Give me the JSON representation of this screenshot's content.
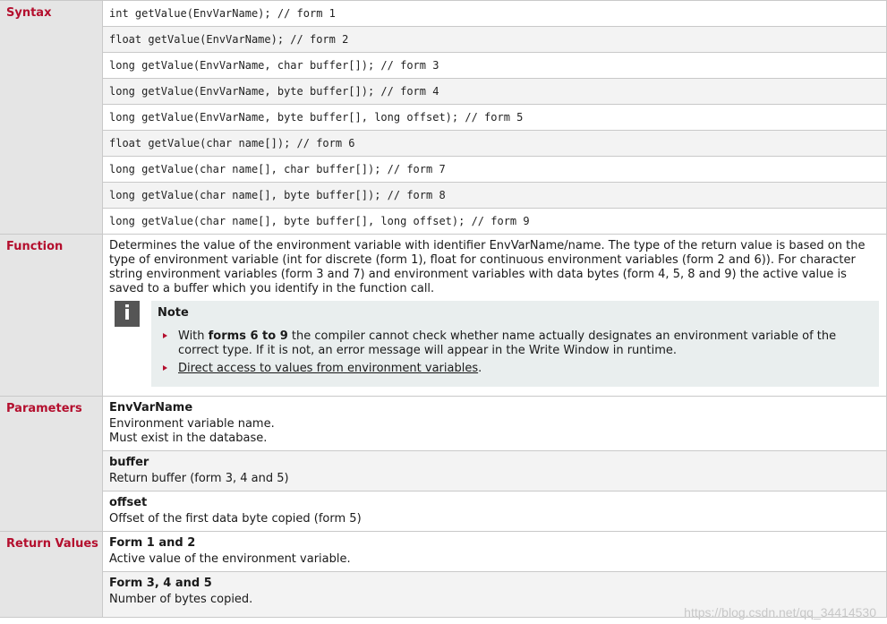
{
  "syntax": {
    "label": "Syntax",
    "forms": [
      "int getValue(EnvVarName); // form 1",
      "float getValue(EnvVarName); // form 2",
      "long getValue(EnvVarName, char buffer[]); // form 3",
      "long getValue(EnvVarName, byte buffer[]); // form 4",
      "long getValue(EnvVarName, byte buffer[], long offset); // form 5",
      "float getValue(char name[]); // form 6",
      "long getValue(char name[], char buffer[]); // form 7",
      "long getValue(char name[], byte buffer[]); // form 8",
      "long getValue(char name[], byte buffer[], long offset); // form 9"
    ]
  },
  "function": {
    "label": "Function",
    "description": "Determines the value of the environment variable with identifier EnvVarName/name. The type of the return value is based on the type of environment variable (int for discrete (form 1), float for continuous environment variables (form 2 and 6)). For character string environment variables (form 3 and 7) and environment variables with data bytes (form 4, 5, 8 and 9) the active value is saved to a buffer which you identify in the function call.",
    "note": {
      "icon_glyph": "i",
      "title": "Note",
      "item1_prefix": "With ",
      "item1_bold": "forms 6 to 9",
      "item1_rest": " the compiler cannot check whether name actually designates an environment variable of the correct type. If it is not, an error message will appear in the Write Window in runtime.",
      "item2_link": "Direct access to values from environment variables",
      "item2_suffix": "."
    }
  },
  "parameters": {
    "label": "Parameters",
    "items": [
      {
        "name": "EnvVarName",
        "line1": "Environment variable name.",
        "line2": "Must exist in the database."
      },
      {
        "name": "buffer",
        "line1": "Return buffer (form 3, 4 and 5)"
      },
      {
        "name": "offset",
        "line1": "Offset of the first data byte copied (form 5)"
      }
    ]
  },
  "return_values": {
    "label": "Return Values",
    "items": [
      {
        "name": "Form 1 and 2",
        "line1": "Active value of the environment variable."
      },
      {
        "name": "Form 3, 4 and 5",
        "line1": "Number of bytes copied."
      }
    ]
  },
  "watermark": "https://blog.csdn.net/qq_34414530"
}
